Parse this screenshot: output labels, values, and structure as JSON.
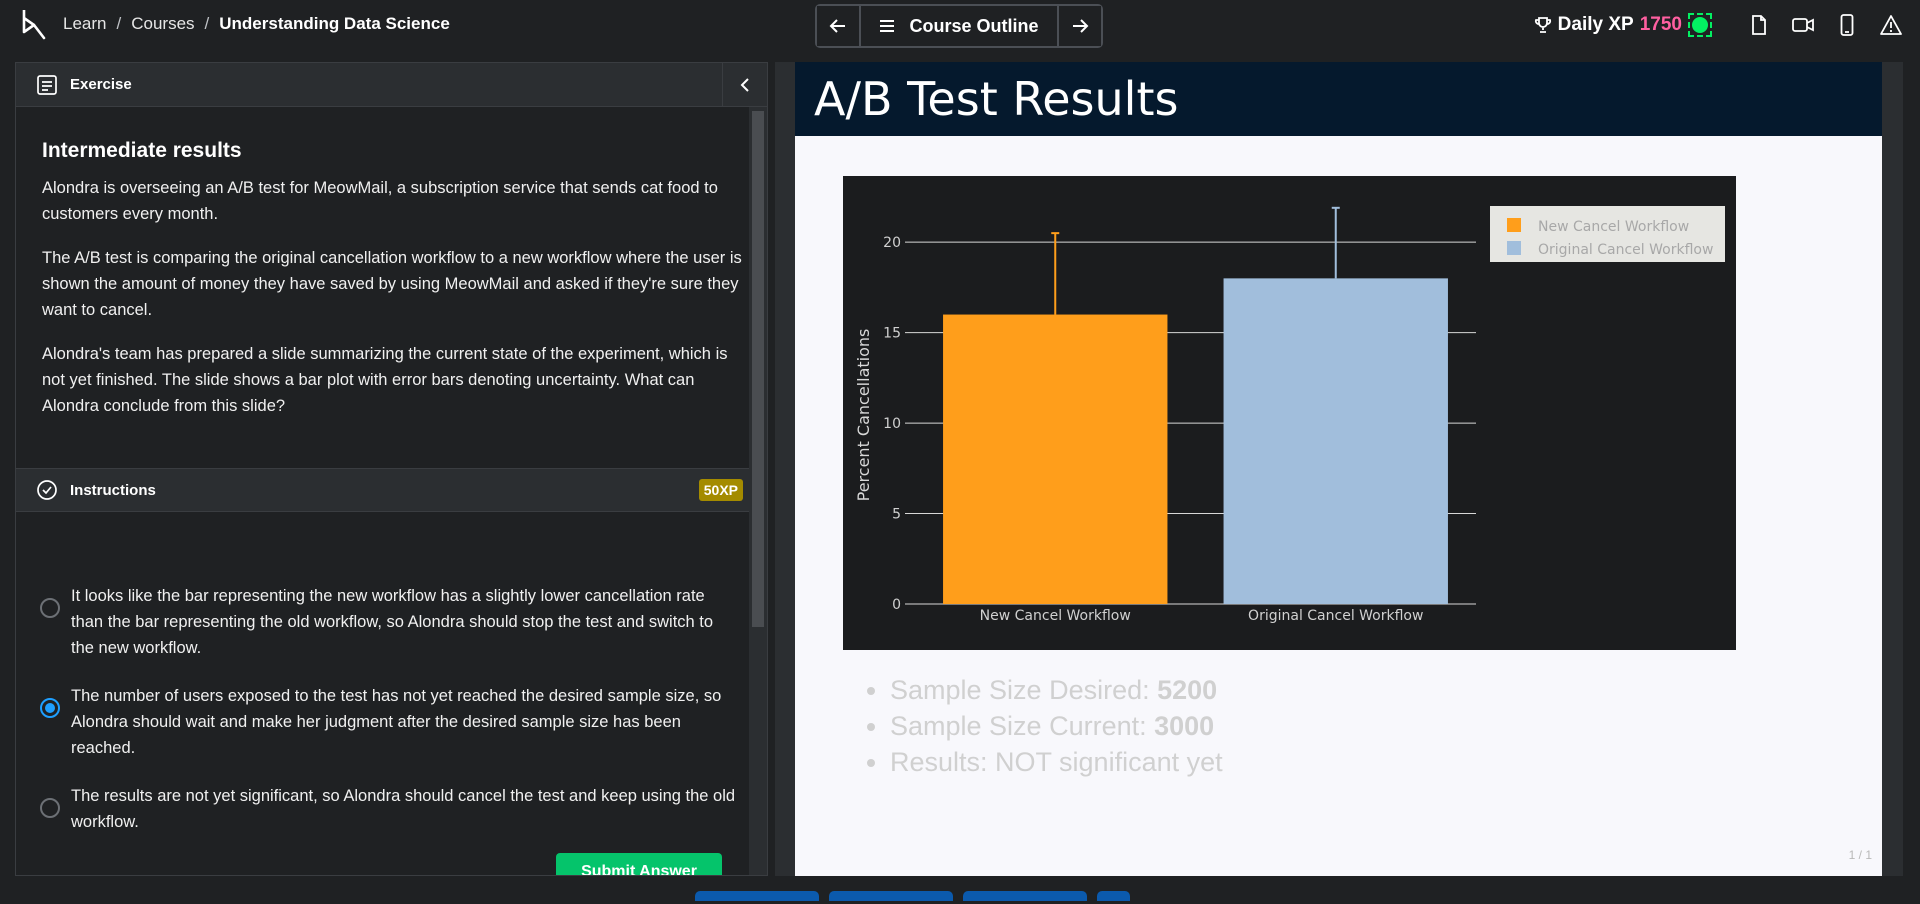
{
  "topbar": {
    "breadcrumb": {
      "learn": "Learn",
      "sep1": "/",
      "courses": "Courses",
      "sep2": "/",
      "course": "Understanding Data Science"
    },
    "course_outline_label": "Course Outline",
    "daily_xp_label": "Daily XP",
    "daily_xp_value": "1750",
    "icons": [
      "trophy-icon",
      "document-icon",
      "video-icon",
      "mobile-icon",
      "warning-icon"
    ]
  },
  "exercise": {
    "header_label": "Exercise",
    "title": "Intermediate results",
    "paragraphs": [
      "Alondra is overseeing an A/B test for MeowMail, a subscription service that sends cat food to customers every month.",
      "The A/B test is comparing the original cancellation workflow to a new workflow where the user is shown the amount of money they have saved by using MeowMail and asked if they're sure they want to cancel.",
      "Alondra's team has prepared a slide summarizing the current state of the experiment, which is not yet finished. The slide shows a bar plot with error bars denoting uncertainty. What can Alondra conclude from this slide?"
    ]
  },
  "instructions": {
    "label": "Instructions",
    "xp_badge": "50XP",
    "options": [
      {
        "text": "It looks like the bar representing the new workflow has a slightly lower cancellation rate than the bar representing the old workflow, so Alondra should stop the test and switch to the new workflow.",
        "selected": false
      },
      {
        "text": "The number of users exposed to the test has not yet reached the desired sample size, so Alondra should wait and make her judgment after the desired sample size has been reached.",
        "selected": true
      },
      {
        "text": "The results are not yet significant, so Alondra should cancel the test and keep using the old workflow.",
        "selected": false
      }
    ],
    "submit_label": "Submit Answer"
  },
  "slide": {
    "title": "A/B Test Results",
    "bullets": [
      {
        "label": "Sample Size Desired: ",
        "value": "5200"
      },
      {
        "label": "Sample Size Current: ",
        "value": "3000"
      },
      {
        "label": "Results: NOT significant yet",
        "value": ""
      }
    ],
    "page_indicator": "1 / 1"
  },
  "chart_data": {
    "type": "bar",
    "categories": [
      "New Cancel Workflow",
      "Original Cancel Workflow"
    ],
    "values": [
      16,
      18
    ],
    "error_upper": [
      20.5,
      21.9
    ],
    "colors": [
      "#ff9e1b",
      "#a1bedc"
    ],
    "ylabel": "Percent Cancellations",
    "xlabel": "",
    "ylim": [
      0,
      22
    ],
    "yticks": [
      0,
      5,
      10,
      15,
      20
    ],
    "grid": true,
    "legend": {
      "position": "top-right",
      "entries": [
        "New Cancel Workflow",
        "Original Cancel Workflow"
      ]
    }
  }
}
